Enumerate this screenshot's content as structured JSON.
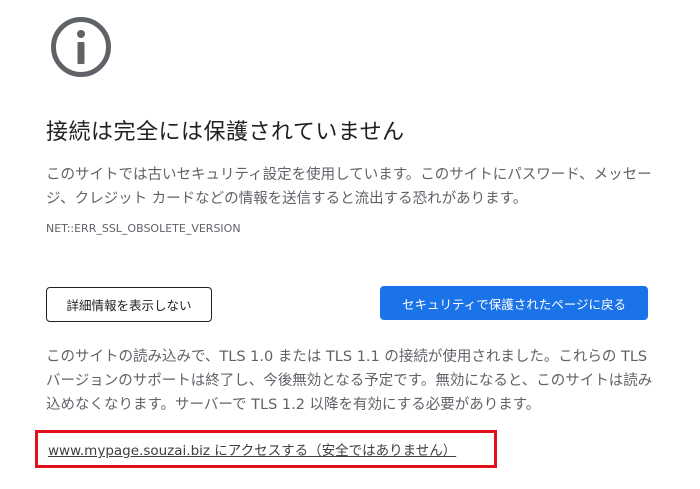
{
  "icon": {
    "name": "info-icon",
    "color": "#5f6368"
  },
  "heading": "接続は完全には保護されていません",
  "description": "このサイトでは古いセキュリティ設定を使用しています。このサイトにパスワード、メッセージ、クレジット カードなどの情報を送信すると流出する恐れがあります。",
  "error_code": "NET::ERR_SSL_OBSOLETE_VERSION",
  "buttons": {
    "details_label": "詳細情報を表示しない",
    "back_to_safety_label": "セキュリティで保護されたページに戻る"
  },
  "details_text": "このサイトの読み込みで、TLS 1.0 または TLS 1.1 の接続が使用されました。これらの TLS バージョンのサポートは終了し、今後無効となる予定です。無効になると、このサイトは読み込めなくなります。サーバーで TLS 1.2 以降を有効にする必要があります。",
  "proceed_link": "www.mypage.souzai.biz にアクセスする（安全ではありません）",
  "colors": {
    "primary": "#1a73e8",
    "text": "#5f6368",
    "heading": "#202124",
    "highlight": "#e0101a"
  }
}
